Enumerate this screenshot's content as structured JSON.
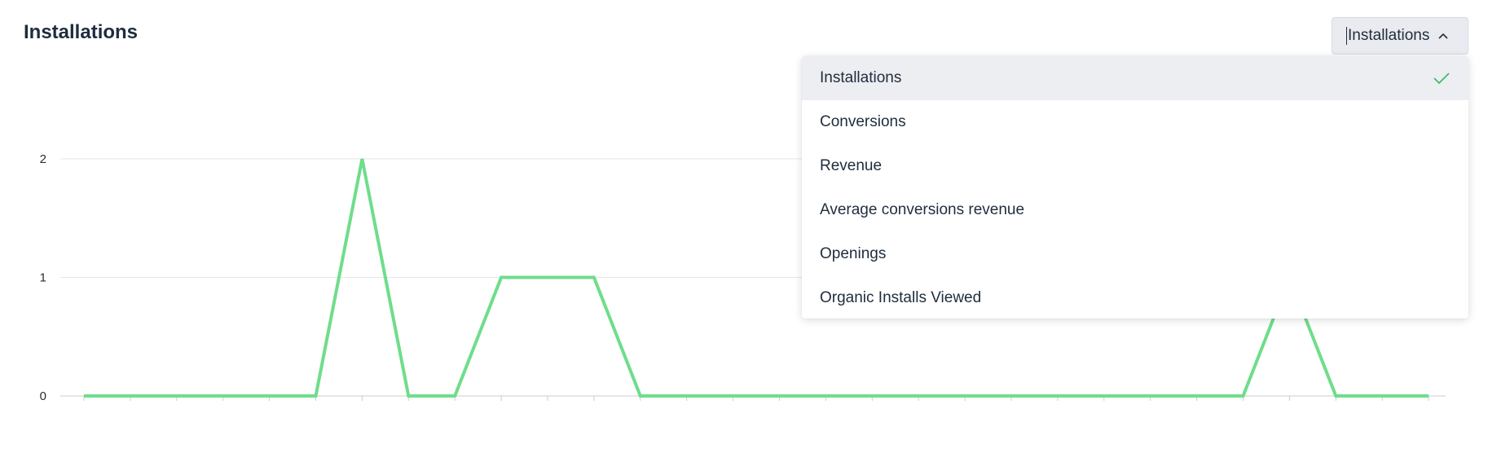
{
  "card": {
    "title": "Installations"
  },
  "metric_select": {
    "value": "Installations",
    "icon": "chevron-up-icon",
    "expanded": true
  },
  "dropdown": {
    "options": [
      {
        "label": "Installations",
        "selected": true
      },
      {
        "label": "Conversions",
        "selected": false
      },
      {
        "label": "Revenue",
        "selected": false
      },
      {
        "label": "Average conversions revenue",
        "selected": false
      },
      {
        "label": "Openings",
        "selected": false
      },
      {
        "label": "Organic Installs Viewed",
        "selected": false
      }
    ],
    "check_icon": "check-icon"
  },
  "colors": {
    "line": "#6fdd8b",
    "grid": "#e6e6e6",
    "axis": "#cccccc",
    "check": "#39c06b",
    "selected_bg": "#eceef2"
  },
  "chart_data": {
    "type": "line",
    "title": "",
    "xlabel": "",
    "ylabel": "",
    "ylim": [
      0,
      2
    ],
    "yticks": [
      "0",
      "1",
      "2"
    ],
    "grid": true,
    "series": [
      {
        "values": [
          0,
          0,
          0,
          0,
          0,
          0,
          2,
          0,
          0,
          1,
          1,
          1,
          0,
          0,
          0,
          0,
          0,
          0,
          0,
          0,
          0,
          0,
          0,
          0,
          0,
          0,
          1,
          0,
          0,
          0
        ]
      }
    ]
  }
}
